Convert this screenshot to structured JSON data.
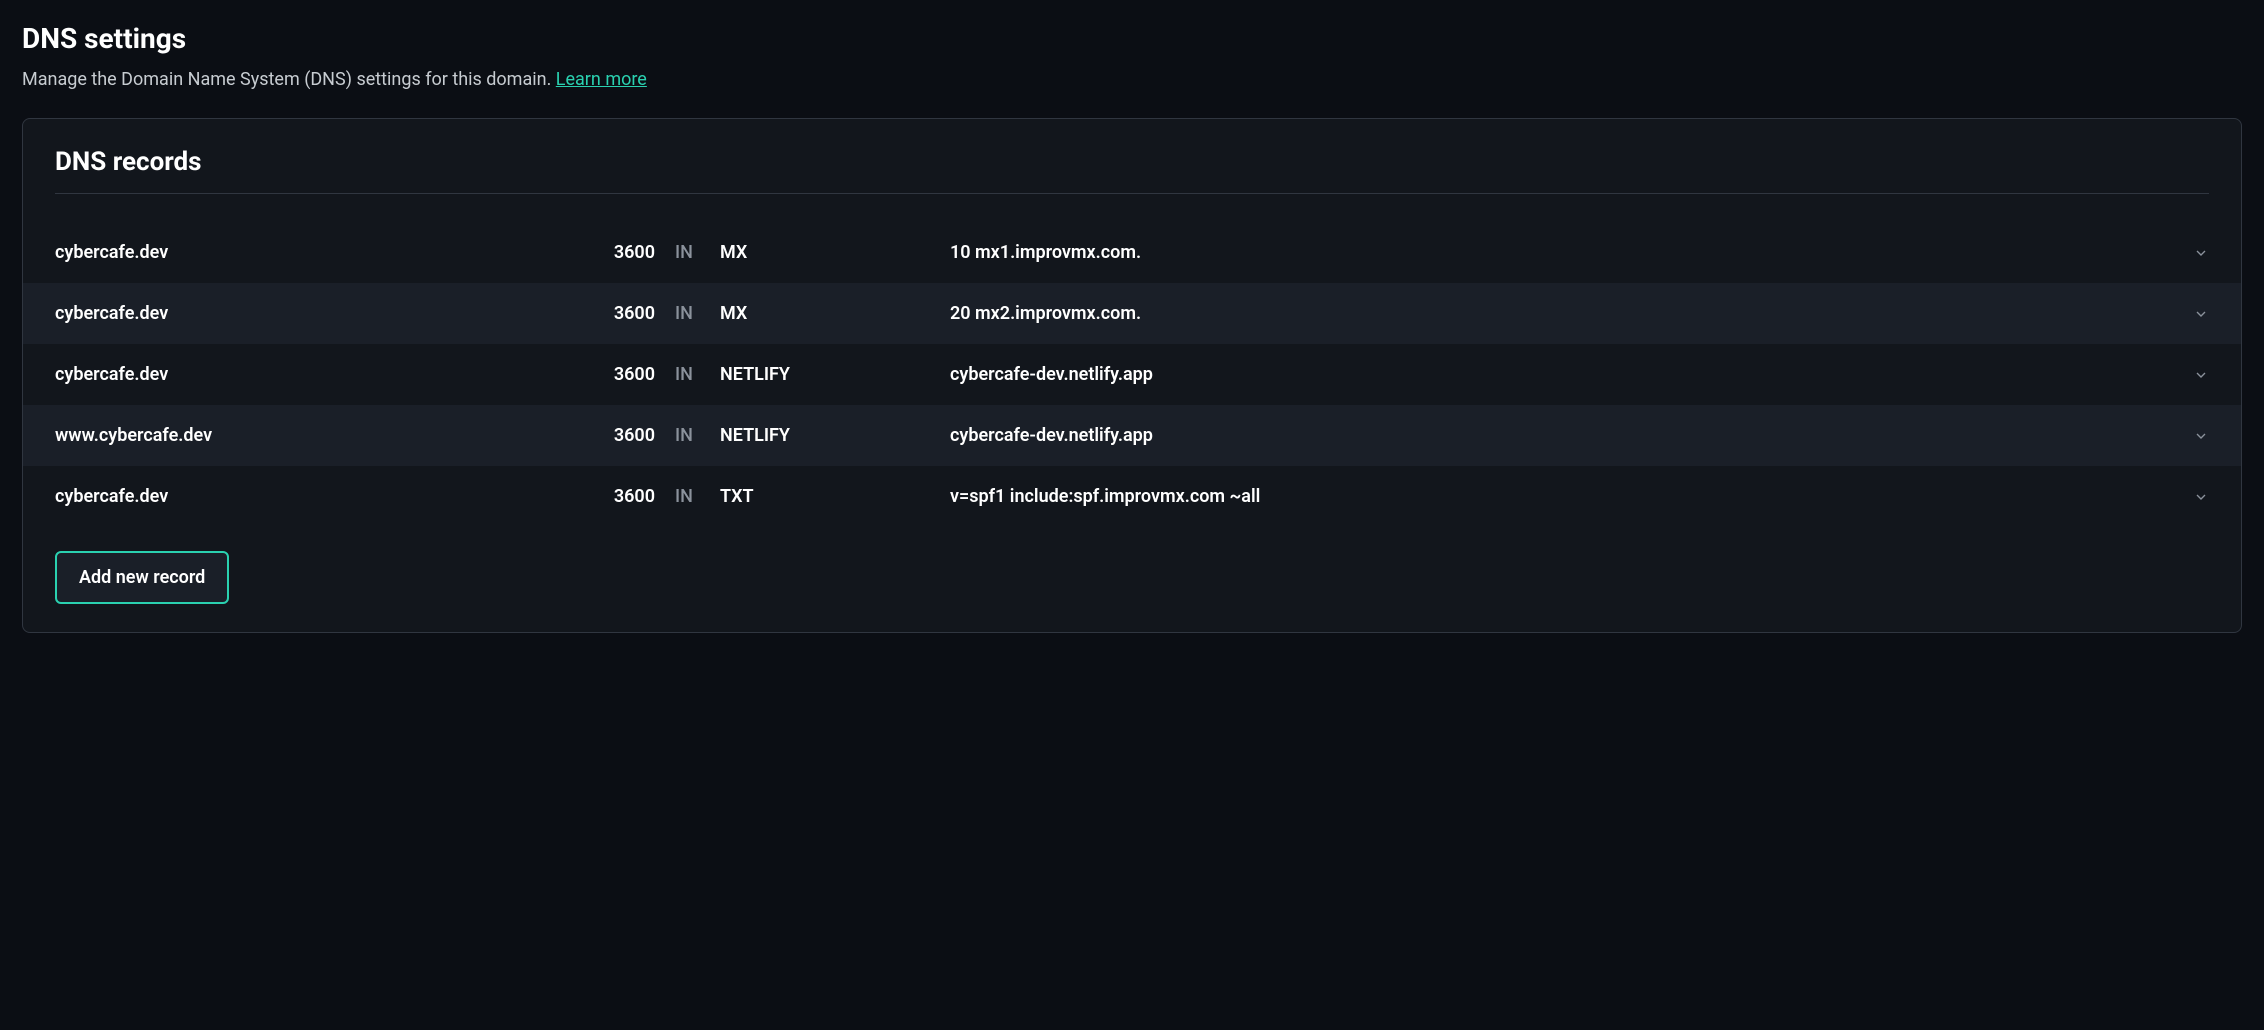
{
  "header": {
    "title": "DNS settings",
    "subtitle_prefix": "Manage the Domain Name System (DNS) settings for this domain. ",
    "learn_more": "Learn more"
  },
  "card": {
    "title": "DNS records",
    "in_label": "IN",
    "add_button": "Add new record",
    "records": [
      {
        "host": "cybercafe.dev",
        "ttl": "3600",
        "type": "MX",
        "value": "10 mx1.improvmx.com."
      },
      {
        "host": "cybercafe.dev",
        "ttl": "3600",
        "type": "MX",
        "value": "20 mx2.improvmx.com."
      },
      {
        "host": "cybercafe.dev",
        "ttl": "3600",
        "type": "NETLIFY",
        "value": "cybercafe-dev.netlify.app"
      },
      {
        "host": "www.cybercafe.dev",
        "ttl": "3600",
        "type": "NETLIFY",
        "value": "cybercafe-dev.netlify.app"
      },
      {
        "host": "cybercafe.dev",
        "ttl": "3600",
        "type": "TXT",
        "value": "v=spf1 include:spf.improvmx.com ~all"
      }
    ]
  }
}
